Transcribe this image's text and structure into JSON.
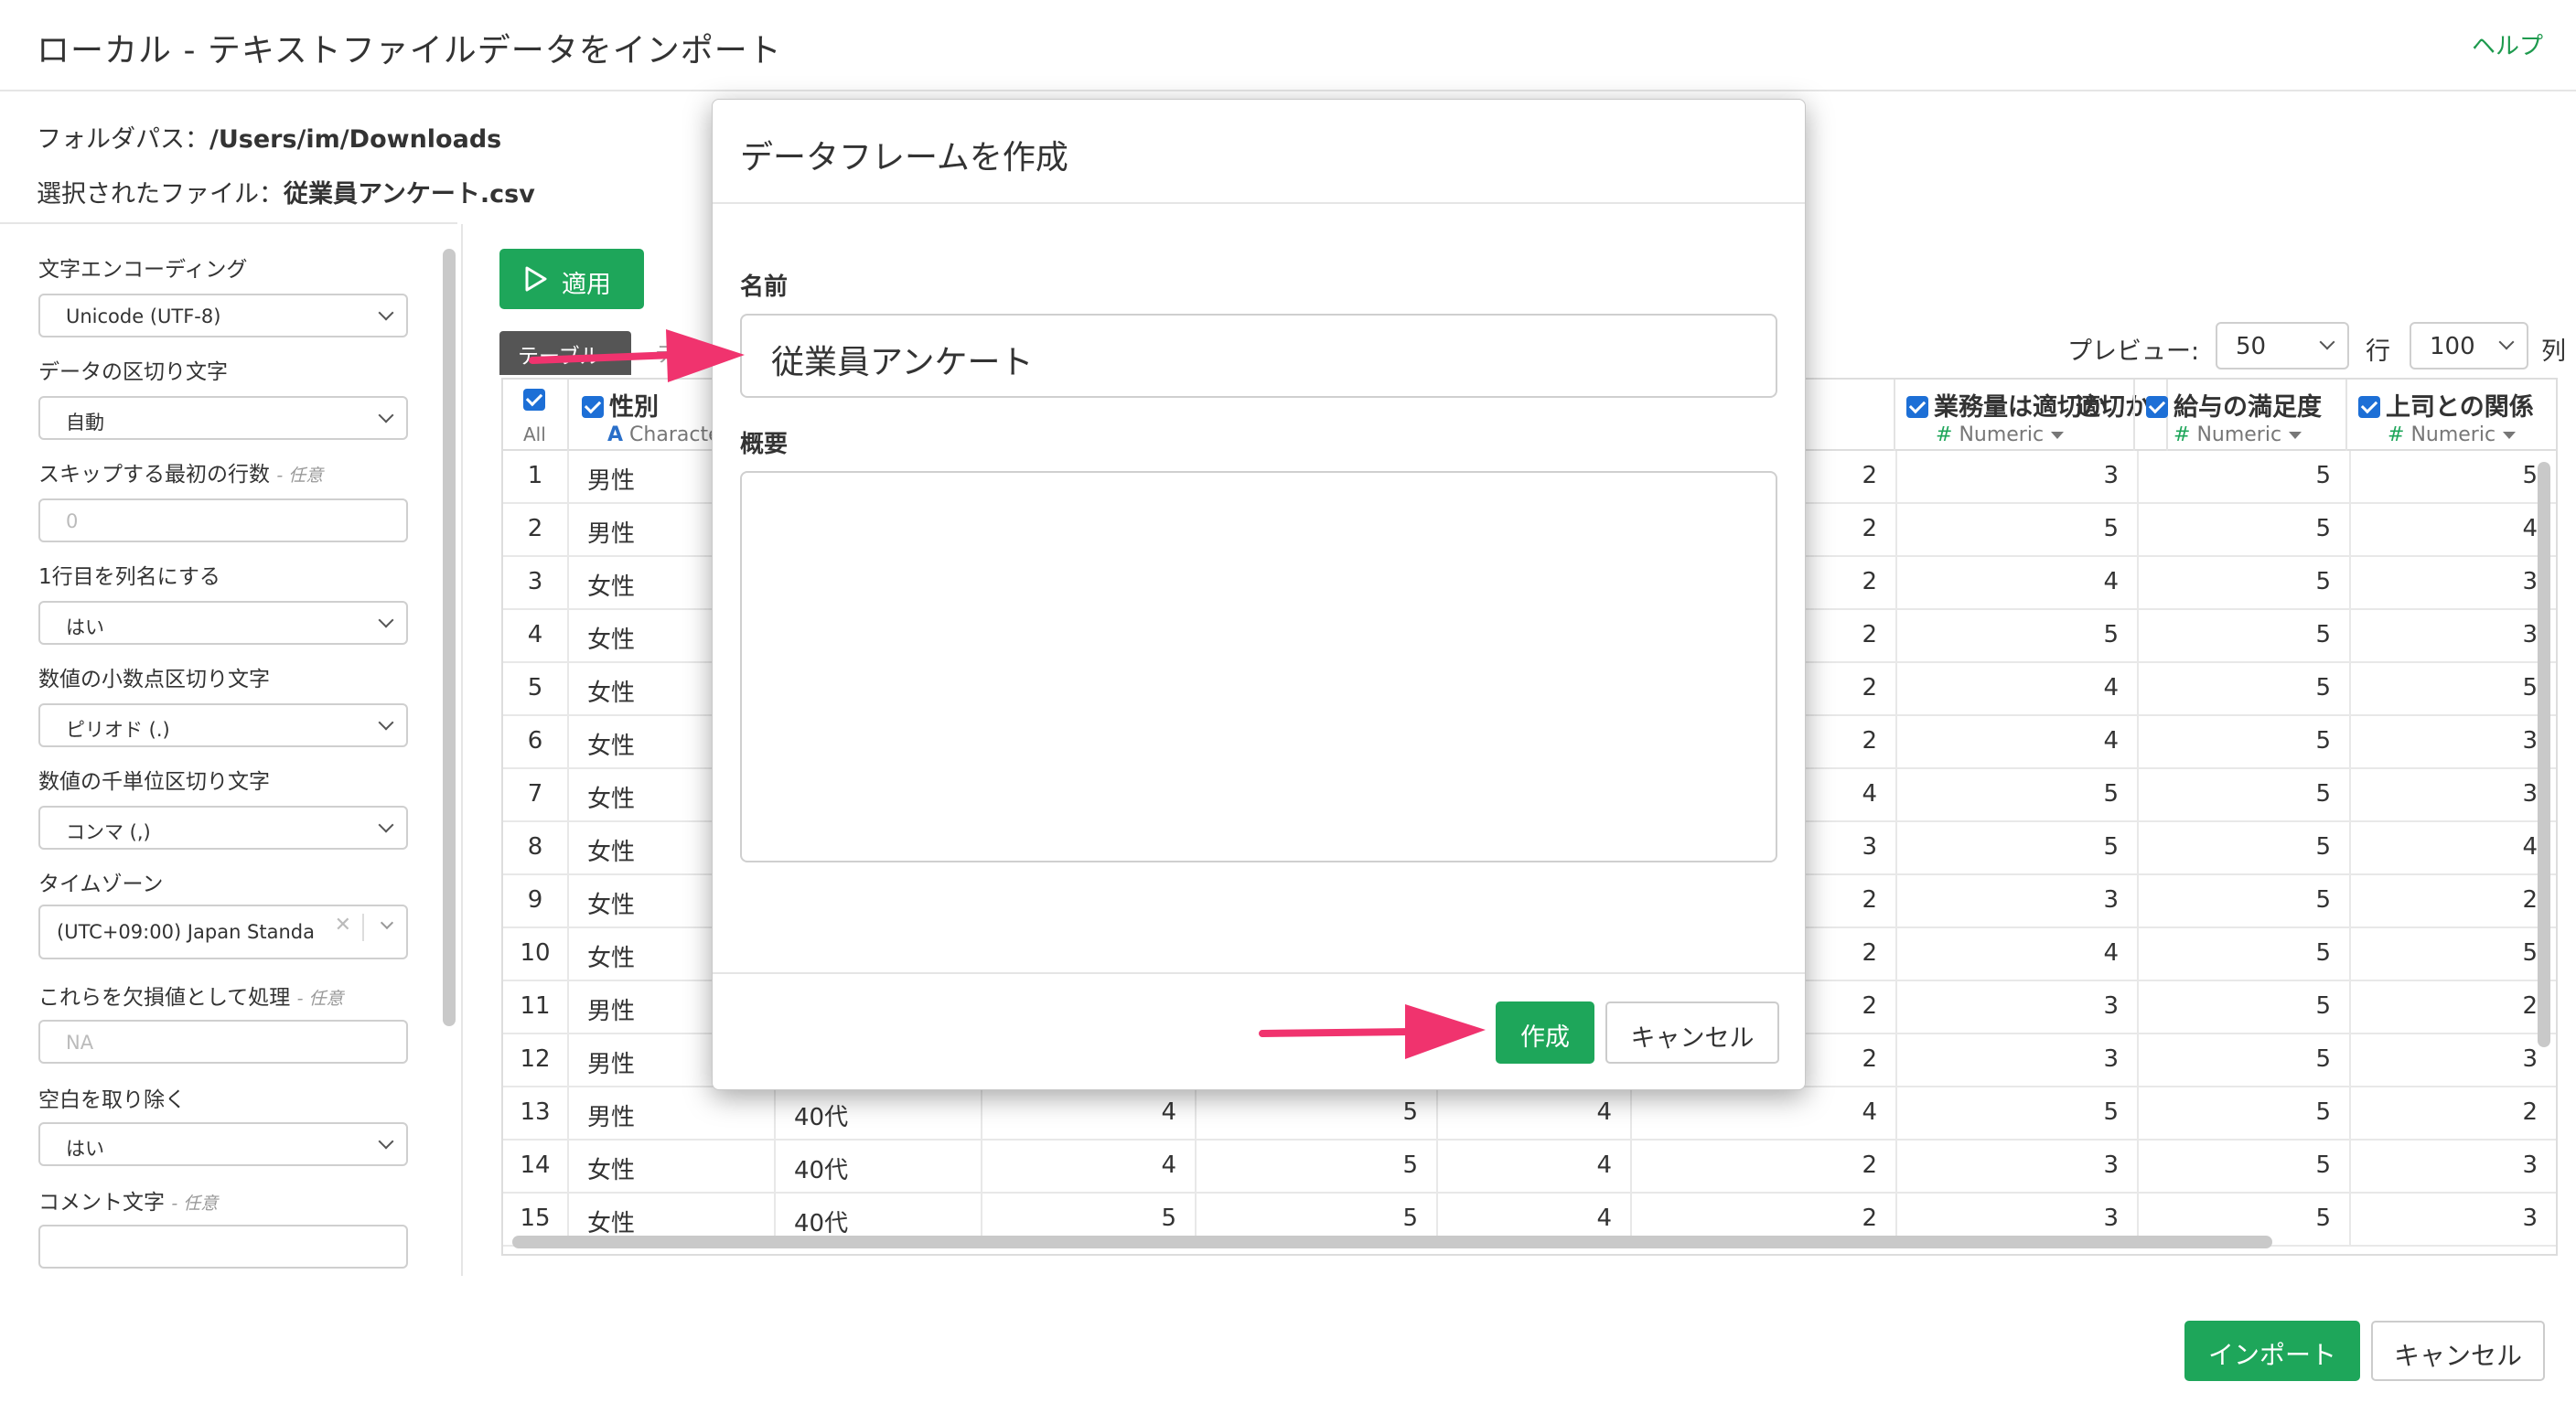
{
  "page": {
    "title": "ローカル - テキストファイルデータをインポート",
    "help": "ヘルプ",
    "folder_label": "フォルダパス：",
    "folder_path": "/Users/im/Downloads",
    "file_label": "選択されたファイル：",
    "file_name": "従業員アンケート.csv"
  },
  "settings": {
    "encoding_label": "文字エンコーディング",
    "encoding_value": "Unicode (UTF-8)",
    "delimiter_label": "データの区切り文字",
    "delimiter_value": "自動",
    "skip_label": "スキップする最初の行数",
    "skip_optional": "- 任意",
    "skip_placeholder": "0",
    "header_label": "1行目を列名にする",
    "header_value": "はい",
    "decimal_label": "数値の小数点区切り文字",
    "decimal_value": "ピリオド (.)",
    "thousands_label": "数値の千単位区切り文字",
    "thousands_value": "コンマ (,)",
    "timezone_label": "タイムゾーン",
    "timezone_value": "(UTC+09:00) Japan Standa",
    "na_label": "これらを欠損値として処理",
    "na_optional": "- 任意",
    "na_placeholder": "NA",
    "trim_label": "空白を取り除く",
    "trim_value": "はい",
    "comment_label": "コメント文字",
    "comment_optional": "- 任意"
  },
  "toolbar": {
    "apply": "適用",
    "tab_table": "テーブル",
    "tab_other": "テ",
    "preview_label": "プレビュー:",
    "preview_value": "50",
    "row_label": "行",
    "rows_value": "100",
    "col_label": "列"
  },
  "grid": {
    "all_label": "All",
    "columns": [
      {
        "name": "性別",
        "type": "Characte",
        "kind": "char"
      },
      {
        "name": "適切か",
        "type": "",
        "kind": "num"
      },
      {
        "name": "業務量は適切か",
        "type": "Numeric",
        "kind": "num"
      },
      {
        "name": "給与の満足度",
        "type": "Numeric",
        "kind": "num"
      },
      {
        "name": "上司との関係",
        "type": "Numeric",
        "kind": "num"
      }
    ],
    "rows": [
      [
        "1",
        "男性",
        "",
        "",
        "",
        "",
        "2",
        "3",
        "5",
        "5"
      ],
      [
        "2",
        "男性",
        "",
        "",
        "",
        "",
        "2",
        "5",
        "5",
        "4"
      ],
      [
        "3",
        "女性",
        "",
        "",
        "",
        "",
        "2",
        "4",
        "5",
        "3"
      ],
      [
        "4",
        "女性",
        "",
        "",
        "",
        "",
        "2",
        "5",
        "5",
        "3"
      ],
      [
        "5",
        "女性",
        "",
        "",
        "",
        "",
        "2",
        "4",
        "5",
        "5"
      ],
      [
        "6",
        "女性",
        "",
        "",
        "",
        "",
        "2",
        "4",
        "5",
        "3"
      ],
      [
        "7",
        "女性",
        "",
        "",
        "",
        "",
        "4",
        "5",
        "5",
        "3"
      ],
      [
        "8",
        "女性",
        "",
        "",
        "",
        "",
        "3",
        "5",
        "5",
        "4"
      ],
      [
        "9",
        "女性",
        "",
        "",
        "",
        "",
        "2",
        "3",
        "5",
        "2"
      ],
      [
        "10",
        "女性",
        "",
        "",
        "",
        "",
        "2",
        "4",
        "5",
        "5"
      ],
      [
        "11",
        "男性",
        "",
        "",
        "",
        "",
        "2",
        "3",
        "5",
        "2"
      ],
      [
        "12",
        "男性",
        "",
        "",
        "",
        "",
        "2",
        "3",
        "5",
        "3"
      ],
      [
        "13",
        "男性",
        "40代",
        "4",
        "5",
        "4",
        "4",
        "5",
        "5",
        "2"
      ],
      [
        "14",
        "女性",
        "40代",
        "4",
        "5",
        "4",
        "2",
        "3",
        "5",
        "3"
      ],
      [
        "15",
        "女性",
        "40代",
        "5",
        "5",
        "4",
        "2",
        "3",
        "5",
        "3"
      ]
    ]
  },
  "footer": {
    "import": "インポート",
    "cancel": "キャンセル"
  },
  "modal": {
    "title": "データフレームを作成",
    "name_label": "名前",
    "name_value": "従業員アンケート",
    "desc_label": "概要",
    "desc_value": "",
    "create": "作成",
    "cancel": "キャンセル"
  },
  "colors": {
    "accent_green": "#1ea65a",
    "checkbox_blue": "#1d6fd6",
    "arrow_pink": "#f0336e"
  }
}
